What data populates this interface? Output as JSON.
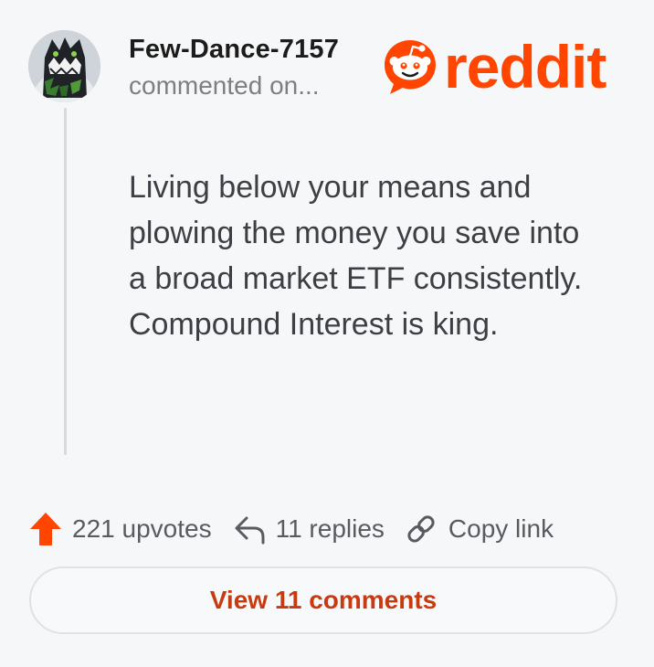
{
  "comment": {
    "username": "Few-Dance-7157",
    "subline": "commented on...",
    "avatar_icon": "dragon-avatar-icon",
    "body": "Living below your means and plowing the money you save into a broad market ETF consistently. Compound Interest is king."
  },
  "brand": {
    "wordmark": "reddit",
    "icon": "reddit-snoo-icon",
    "color": "#ff4500"
  },
  "actions": {
    "upvotes": "221 upvotes",
    "upvote_icon": "upvote-arrow-icon",
    "upvote_color": "#ff4500",
    "replies": "11 replies",
    "reply_icon": "reply-arrow-icon",
    "copy_link": "Copy link",
    "link_icon": "link-icon"
  },
  "view_comments": {
    "label": "View 11 comments",
    "color": "#c83a10"
  }
}
